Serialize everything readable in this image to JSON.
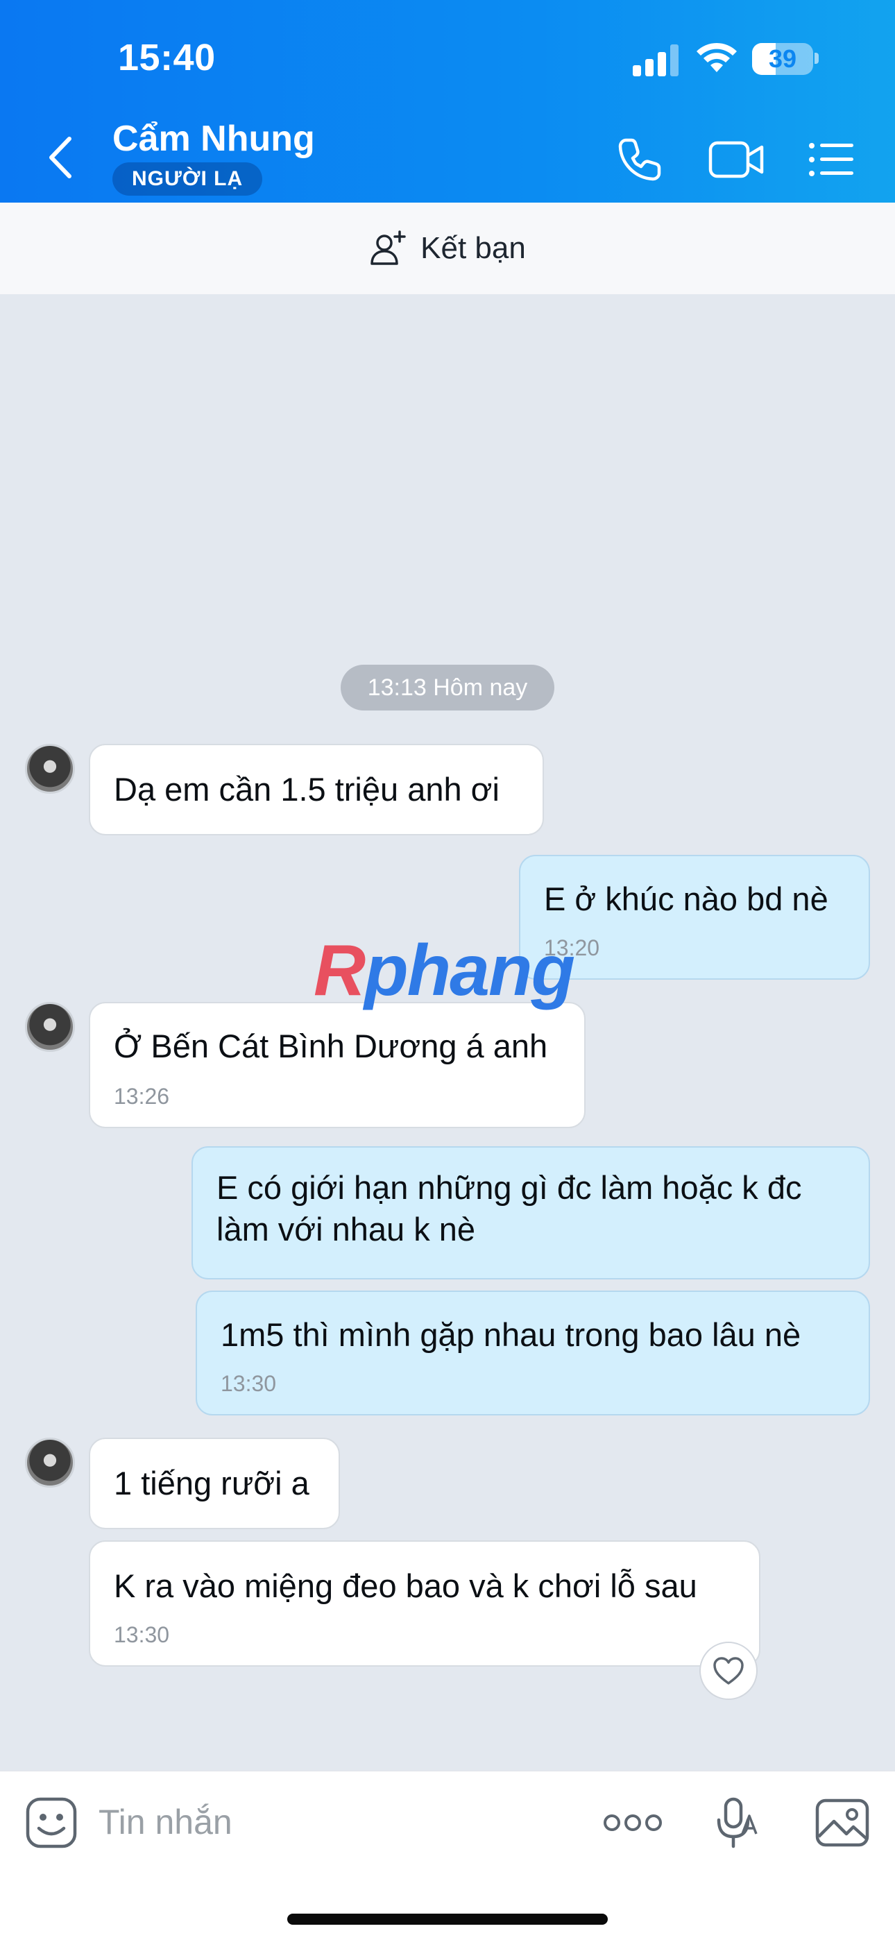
{
  "status_bar": {
    "time": "15:40",
    "battery": "39",
    "battery_level": 0.39
  },
  "header": {
    "contact_name": "Cẩm Nhung",
    "badge": "NGƯỜI LẠ"
  },
  "friend_bar": {
    "label": "Kết bạn"
  },
  "date_separator": "13:13 Hôm nay",
  "messages": [
    {
      "side": "in",
      "text": "Dạ em cần 1.5 triệu anh ơi",
      "time": ""
    },
    {
      "side": "out",
      "text": "E ở khúc nào bd nè",
      "time": "13:20"
    },
    {
      "side": "in",
      "text": "Ở Bến Cát Bình Dương á anh",
      "time": "13:26"
    },
    {
      "side": "out",
      "text_line1": "E có giới hạn những gì đc làm hoặc k đc",
      "text_line2": "làm với nhau k nè",
      "time": ""
    },
    {
      "side": "out",
      "text": "1m5 thì mình gặp nhau trong bao lâu nè",
      "time": "13:30"
    },
    {
      "side": "in",
      "text": "1 tiếng rưỡi a",
      "time": ""
    },
    {
      "side": "in",
      "text": "K ra vào miệng đeo bao và k chơi lỗ sau",
      "time": "13:30"
    }
  ],
  "watermark": {
    "first": "R",
    "rest": "phang"
  },
  "composer": {
    "placeholder": "Tin nhắn"
  },
  "colors": {
    "header_start": "#0a78f2",
    "header_end": "#12a3ef",
    "outgoing_bubble": "#d3effd",
    "incoming_bubble": "#ffffff",
    "chat_bg": "#e3e8ef"
  },
  "icons": {
    "back": "chevron-left-icon",
    "call": "phone-icon",
    "video": "video-camera-icon",
    "menu": "list-menu-icon",
    "add_friend": "add-person-icon",
    "sticker": "sticker-face-icon",
    "more": "more-dots-icon",
    "voice": "microphone-icon",
    "gallery": "image-icon",
    "react": "heart-icon"
  }
}
